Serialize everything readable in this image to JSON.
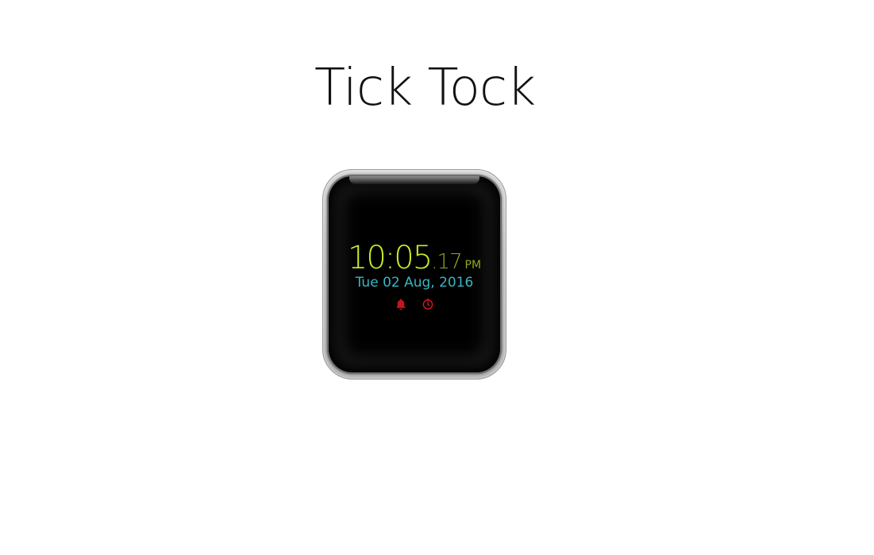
{
  "page": {
    "title": "Tick Tock"
  },
  "watch": {
    "time": {
      "hours_minutes": "10:05",
      "seconds": ".17",
      "ampm": "PM"
    },
    "date": "Tue 02 Aug, 2016",
    "status_icons": [
      {
        "name": "alarm-bell-icon",
        "color": "#c8151b"
      },
      {
        "name": "timer-icon",
        "color": "#c8151b"
      }
    ]
  },
  "colors": {
    "time_main": "#c6ec2a",
    "time_secondary": "#8fa81f",
    "date": "#36b7c4",
    "icons": "#c8151b",
    "screen": "#000000",
    "case": "#bdbdbd"
  }
}
